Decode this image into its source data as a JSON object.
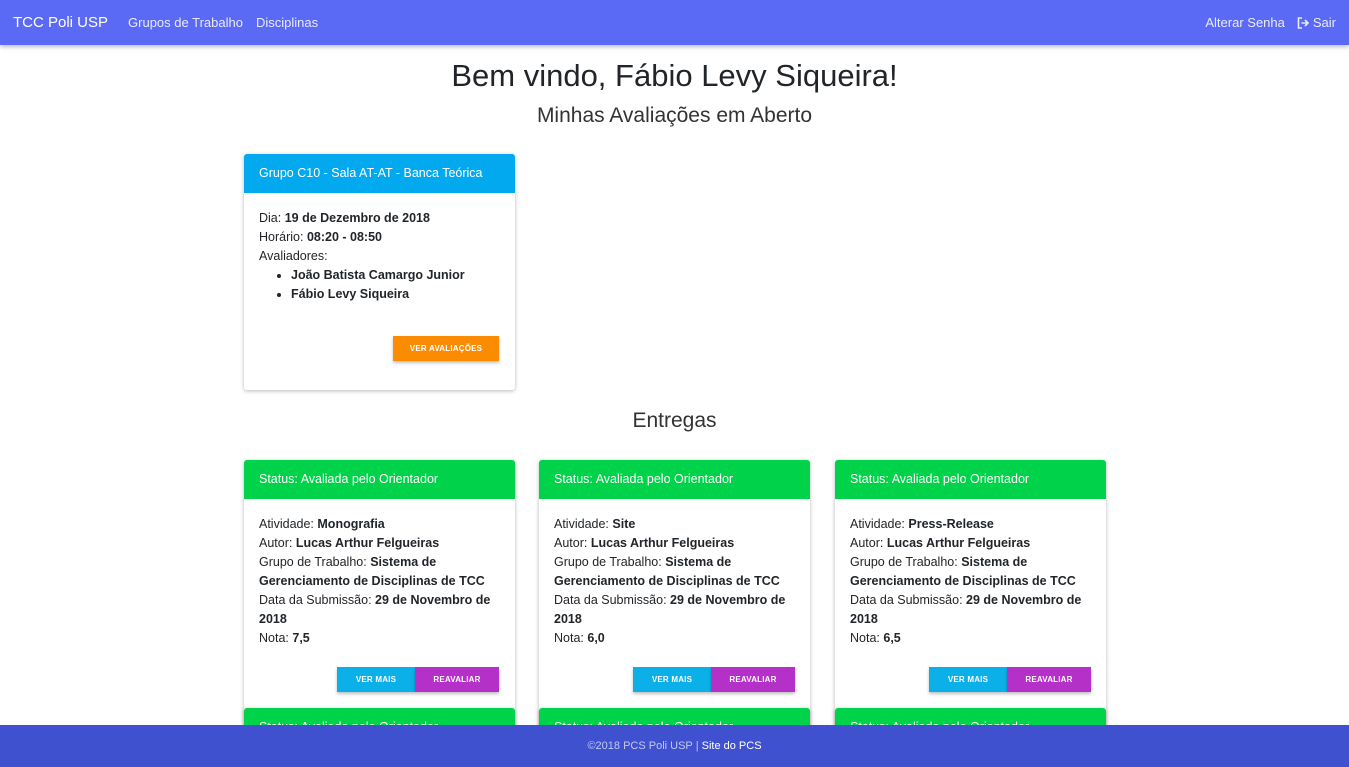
{
  "nav": {
    "brand": "TCC Poli USP",
    "links": [
      "Grupos de Trabalho",
      "Disciplinas"
    ],
    "change_password": "Alterar Senha",
    "logout": "Sair"
  },
  "welcome": "Bem vindo, Fábio Levy Siqueira!",
  "open_evaluations_title": "Minhas Avaliações em Aberto",
  "evaluation_card": {
    "header": "Grupo C10 - Sala AT-AT - Banca Teórica",
    "day_label": "Dia:",
    "day": "19 de Dezembro de 2018",
    "time_label": "Horário:",
    "time": "08:20 - 08:50",
    "evaluators_label": "Avaliadores:",
    "evaluators": [
      "João Batista Camargo Junior",
      "Fábio Levy Siqueira"
    ],
    "button": "VER AVALIAÇÕES",
    "header_color": "#03a9ee",
    "button_color": "#fb8b00"
  },
  "deliveries_title": "Entregas",
  "deliveries": [
    {
      "status": "Status: Avaliada pelo Orientador",
      "activity_label": "Atividade:",
      "activity": "Monografia",
      "author_label": "Autor:",
      "author": "Lucas Arthur Felgueiras",
      "group_label": "Grupo de Trabalho:",
      "group": "Sistema de Gerenciamento de Disciplinas de TCC",
      "date_label": "Data da Submissão:",
      "date": "29 de Novembro de 2018",
      "grade_label": "Nota:",
      "grade": "7,5",
      "view_button": "VER MAIS",
      "reevaluate_button": "REAVALIAR"
    },
    {
      "status": "Status: Avaliada pelo Orientador",
      "activity_label": "Atividade:",
      "activity": "Site",
      "author_label": "Autor:",
      "author": "Lucas Arthur Felgueiras",
      "group_label": "Grupo de Trabalho:",
      "group": "Sistema de Gerenciamento de Disciplinas de TCC",
      "date_label": "Data da Submissão:",
      "date": "29 de Novembro de 2018",
      "grade_label": "Nota:",
      "grade": "6,0",
      "view_button": "VER MAIS",
      "reevaluate_button": "REAVALIAR"
    },
    {
      "status": "Status: Avaliada pelo Orientador",
      "activity_label": "Atividade:",
      "activity": "Press-Release",
      "author_label": "Autor:",
      "author": "Lucas Arthur Felgueiras",
      "group_label": "Grupo de Trabalho:",
      "group": "Sistema de Gerenciamento de Disciplinas de TCC",
      "date_label": "Data da Submissão:",
      "date": "29 de Novembro de 2018",
      "grade_label": "Nota:",
      "grade": "6,5",
      "view_button": "VER MAIS",
      "reevaluate_button": "REAVALIAR"
    }
  ],
  "next_row_status": "Status: Avaliada pelo Orientador",
  "colors": {
    "navbar": "#5b6af5",
    "footer": "#3f51cf",
    "status_green": "#00d24a",
    "eval_blue": "#03a9ee",
    "btn_blue": "#0bb0e8",
    "btn_purple": "#b530c9"
  },
  "footer": {
    "copyright": "©2018 PCS Poli USP",
    "separator": "|",
    "link": "Site do PCS"
  },
  "icons": {
    "logout": "sign-out-icon"
  }
}
